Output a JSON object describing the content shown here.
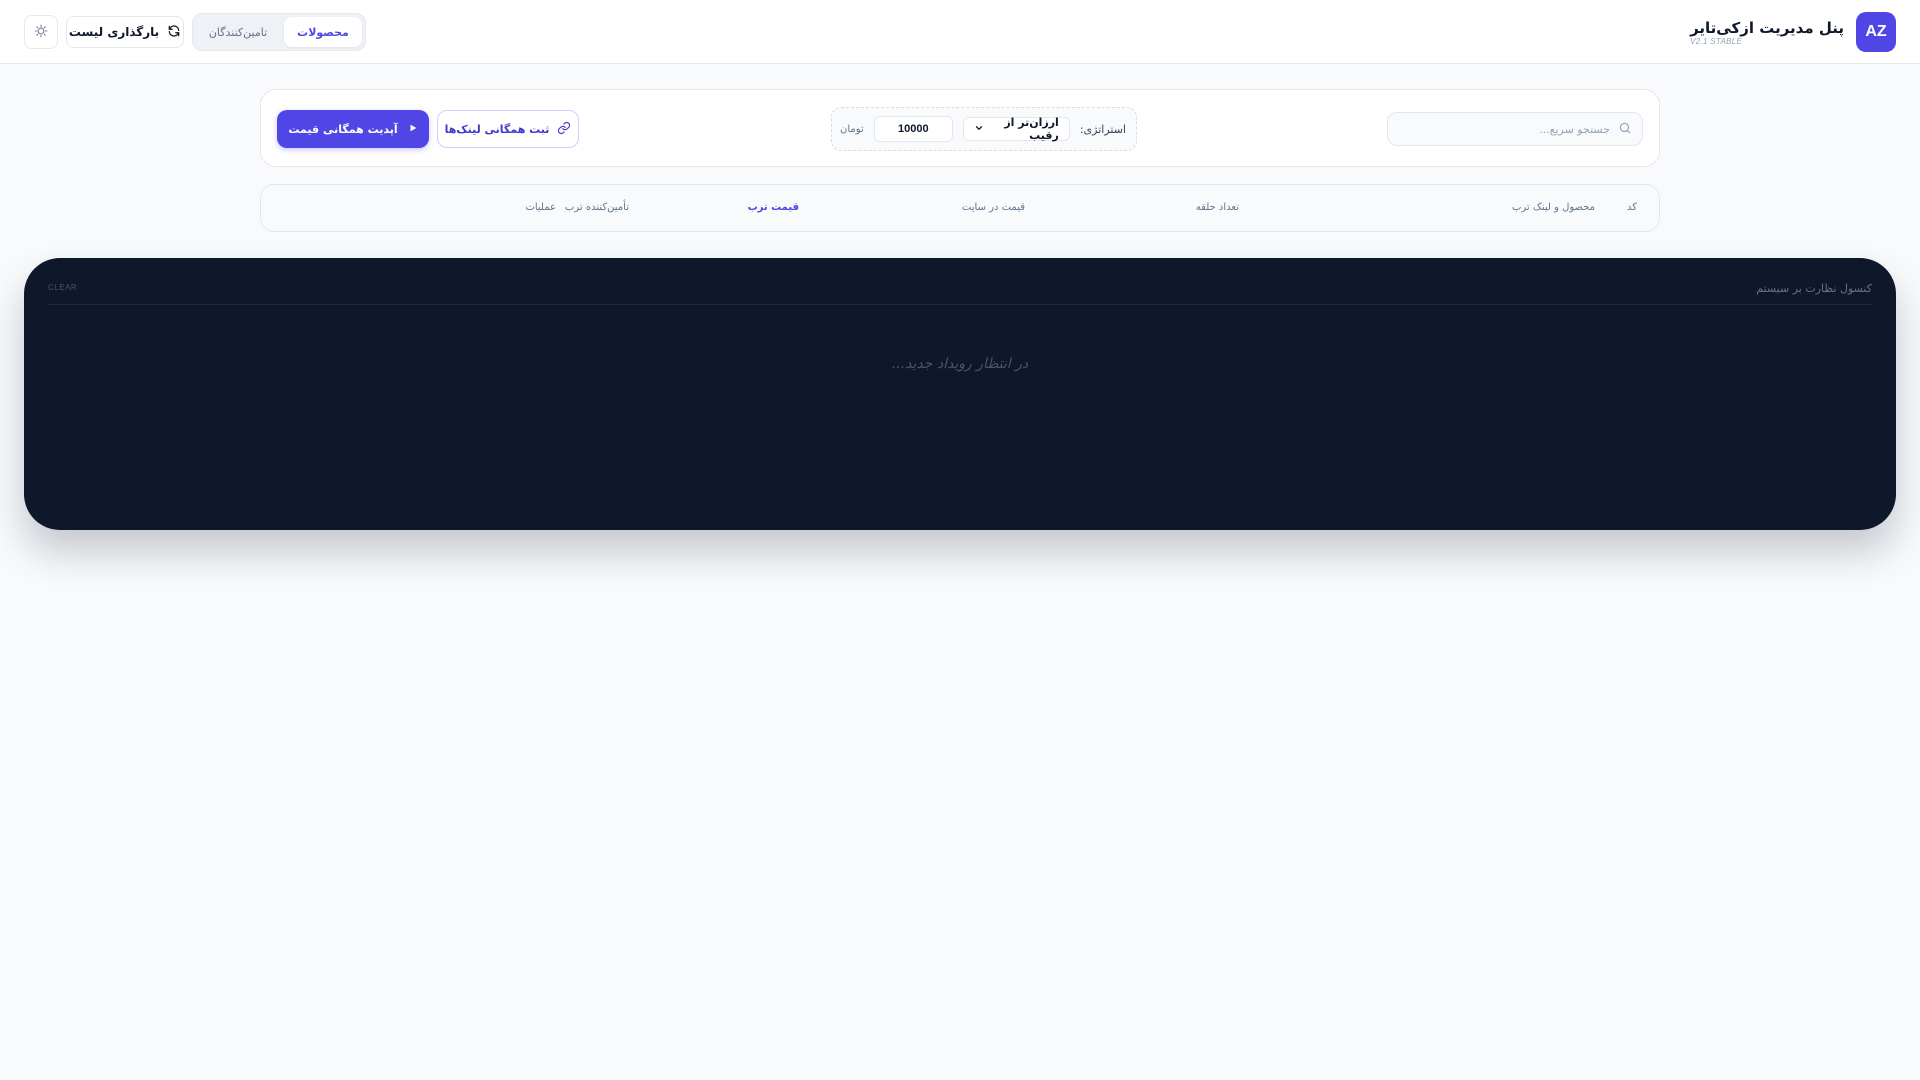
{
  "app": {
    "title": "پنل مدیریت ازکی‌تایر",
    "version": "V2.1 STABLE",
    "logo_text": "AZ"
  },
  "header": {
    "reload_label": "بارگذاری لیست",
    "tabs": [
      {
        "label": "محصولات",
        "active": true
      },
      {
        "label": "تامین‌کنندگان",
        "active": false
      }
    ]
  },
  "toolbar": {
    "search_placeholder": "جستجو سریع...",
    "strategy_label": "استراتژی:",
    "strategy_selected": "ارزان‌تر از رقیب",
    "amount_value": "10000",
    "amount_unit": "تومان",
    "links_button": "ثبت همگانی لینک‌ها",
    "update_button": "آپدیت همگانی قیمت"
  },
  "table": {
    "columns": [
      {
        "label": "کد",
        "active": false
      },
      {
        "label": "محصول و لینک ترب",
        "active": false
      },
      {
        "label": "تعداد حلقه",
        "active": false
      },
      {
        "label": "قیمت در سایت",
        "active": false
      },
      {
        "label": "قیمت ترب",
        "active": true
      },
      {
        "label": "تأمین‌کننده ترب",
        "active": false
      },
      {
        "label": "عملیات",
        "active": false
      }
    ]
  },
  "console": {
    "title": "کنسول نظارت بر سیستم",
    "clear_label": "CLEAR",
    "empty_message": "در انتظار رویداد جدید..."
  },
  "colors": {
    "accent": "#4f46e5",
    "console_bg": "#0f172a",
    "page_bg": "#f8fafc"
  },
  "icons": {
    "settings": "sun-icon",
    "reload": "refresh-icon",
    "search": "search-icon",
    "links": "link-icon",
    "update": "play-icon",
    "select": "chevron-down-icon"
  }
}
